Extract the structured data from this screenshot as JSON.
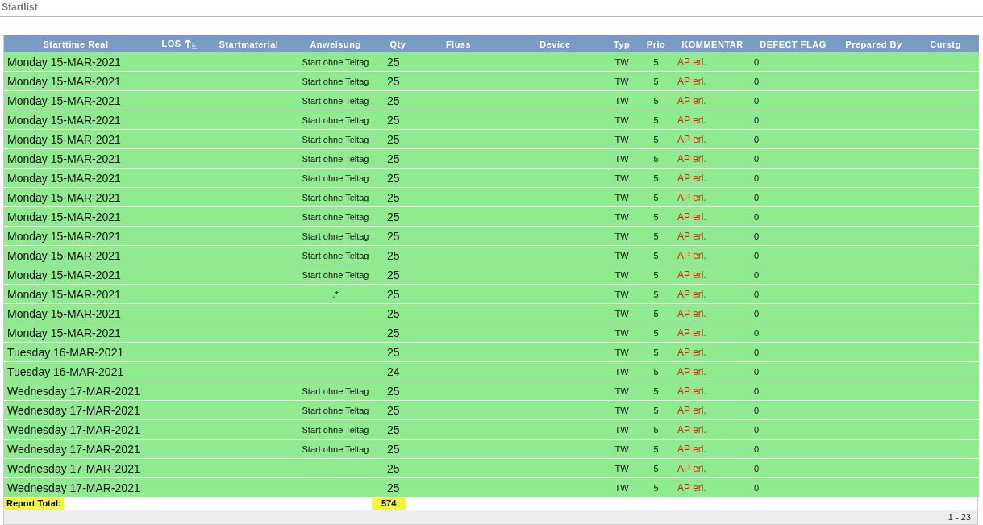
{
  "title": "Startlist",
  "table": {
    "columns": [
      {
        "label": "Starttime Real",
        "sorted": false
      },
      {
        "label": "LOS",
        "sorted": true
      },
      {
        "label": "Startmaterial",
        "sorted": false
      },
      {
        "label": "Anweisung",
        "sorted": false
      },
      {
        "label": "Qty",
        "sorted": false
      },
      {
        "label": "Fluss",
        "sorted": false
      },
      {
        "label": "Device",
        "sorted": false
      },
      {
        "label": "Typ",
        "sorted": false
      },
      {
        "label": "Prio",
        "sorted": false
      },
      {
        "label": "KOMMENTAR",
        "sorted": false
      },
      {
        "label": "DEFECT FLAG",
        "sorted": false
      },
      {
        "label": "Prepared By",
        "sorted": false
      },
      {
        "label": "Curstg",
        "sorted": false
      }
    ],
    "rows": [
      {
        "start": "Monday 15-MAR-2021",
        "anweisung": "Start ohne Teltag",
        "qty": "25",
        "typ": "TW",
        "prio": "5",
        "kommentar": "AP erl.",
        "defect": "0"
      },
      {
        "start": "Monday 15-MAR-2021",
        "anweisung": "Start ohne Teltag",
        "qty": "25",
        "typ": "TW",
        "prio": "5",
        "kommentar": "AP erl.",
        "defect": "0"
      },
      {
        "start": "Monday 15-MAR-2021",
        "anweisung": "Start ohne Teltag",
        "qty": "25",
        "typ": "TW",
        "prio": "5",
        "kommentar": "AP erl.",
        "defect": "0"
      },
      {
        "start": "Monday 15-MAR-2021",
        "anweisung": "Start ohne Teltag",
        "qty": "25",
        "typ": "TW",
        "prio": "5",
        "kommentar": "AP erl.",
        "defect": "0"
      },
      {
        "start": "Monday 15-MAR-2021",
        "anweisung": "Start ohne Teltag",
        "qty": "25",
        "typ": "TW",
        "prio": "5",
        "kommentar": "AP erl.",
        "defect": "0"
      },
      {
        "start": "Monday 15-MAR-2021",
        "anweisung": "Start ohne Teltag",
        "qty": "25",
        "typ": "TW",
        "prio": "5",
        "kommentar": "AP erl.",
        "defect": "0"
      },
      {
        "start": "Monday 15-MAR-2021",
        "anweisung": "Start ohne Teltag",
        "qty": "25",
        "typ": "TW",
        "prio": "5",
        "kommentar": "AP erl.",
        "defect": "0"
      },
      {
        "start": "Monday 15-MAR-2021",
        "anweisung": "Start ohne Teltag",
        "qty": "25",
        "typ": "TW",
        "prio": "5",
        "kommentar": "AP erl.",
        "defect": "0"
      },
      {
        "start": "Monday 15-MAR-2021",
        "anweisung": "Start ohne Teltag",
        "qty": "25",
        "typ": "TW",
        "prio": "5",
        "kommentar": "AP erl.",
        "defect": "0"
      },
      {
        "start": "Monday 15-MAR-2021",
        "anweisung": "Start ohne Teltag",
        "qty": "25",
        "typ": "TW",
        "prio": "5",
        "kommentar": "AP erl.",
        "defect": "0"
      },
      {
        "start": "Monday 15-MAR-2021",
        "anweisung": "Start ohne Teltag",
        "qty": "25",
        "typ": "TW",
        "prio": "5",
        "kommentar": "AP erl.",
        "defect": "0"
      },
      {
        "start": "Monday 15-MAR-2021",
        "anweisung": "Start ohne Teltag",
        "qty": "25",
        "typ": "TW",
        "prio": "5",
        "kommentar": "AP erl.",
        "defect": "0"
      },
      {
        "start": "Monday 15-MAR-2021",
        "anweisung": ".*",
        "qty": "25",
        "typ": "TW",
        "prio": "5",
        "kommentar": "AP erl.",
        "defect": "0"
      },
      {
        "start": "Monday 15-MAR-2021",
        "qty": "25",
        "typ": "TW",
        "prio": "5",
        "kommentar": "AP erl.",
        "defect": "0"
      },
      {
        "start": "Monday 15-MAR-2021",
        "qty": "25",
        "typ": "TW",
        "prio": "5",
        "kommentar": "AP erl.",
        "defect": "0"
      },
      {
        "start": "Tuesday 16-MAR-2021",
        "qty": "25",
        "typ": "TW",
        "prio": "5",
        "kommentar": "AP erl.",
        "defect": "0"
      },
      {
        "start": "Tuesday 16-MAR-2021",
        "qty": "24",
        "typ": "TW",
        "prio": "5",
        "kommentar": "AP erl.",
        "defect": "0"
      },
      {
        "start": "Wednesday 17-MAR-2021",
        "anweisung": "Start ohne Teltag",
        "qty": "25",
        "typ": "TW",
        "prio": "5",
        "kommentar": "AP erl.",
        "defect": "0"
      },
      {
        "start": "Wednesday 17-MAR-2021",
        "anweisung": "Start ohne Teltag",
        "qty": "25",
        "typ": "TW",
        "prio": "5",
        "kommentar": "AP erl.",
        "defect": "0"
      },
      {
        "start": "Wednesday 17-MAR-2021",
        "anweisung": "Start ohne Teltag",
        "qty": "25",
        "typ": "TW",
        "prio": "5",
        "kommentar": "AP erl.",
        "defect": "0"
      },
      {
        "start": "Wednesday 17-MAR-2021",
        "anweisung": "Start ohne Teltag",
        "qty": "25",
        "typ": "TW",
        "prio": "5",
        "kommentar": "AP erl.",
        "defect": "0"
      },
      {
        "start": "Wednesday 17-MAR-2021",
        "qty": "25",
        "typ": "TW",
        "prio": "5",
        "kommentar": "AP erl.",
        "defect": "0"
      },
      {
        "start": "Wednesday 17-MAR-2021",
        "qty": "25",
        "typ": "TW",
        "prio": "5",
        "kommentar": "AP erl.",
        "defect": "0"
      }
    ]
  },
  "report_total": {
    "label": "Report Total:",
    "value": "574"
  },
  "pagination": "1 - 23"
}
